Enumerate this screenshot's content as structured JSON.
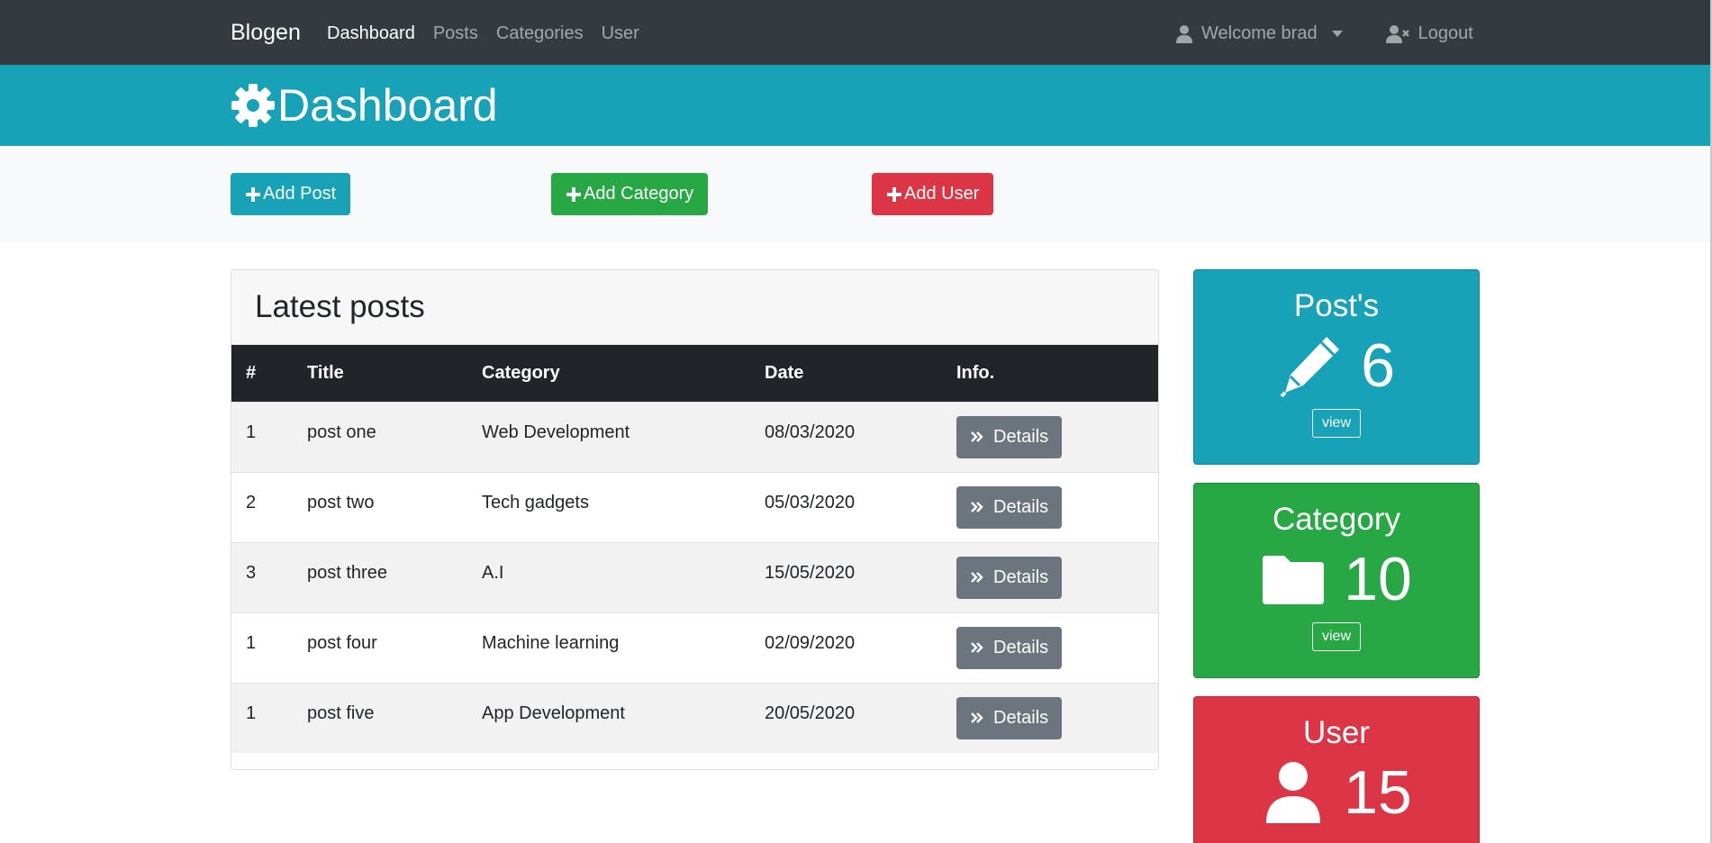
{
  "navbar": {
    "brand": "Blogen",
    "links": [
      {
        "label": "Dashboard",
        "active": true
      },
      {
        "label": "Posts",
        "active": false
      },
      {
        "label": "Categories",
        "active": false
      },
      {
        "label": "User",
        "active": false
      }
    ],
    "welcome_label": "Welcome brad",
    "logout_label": "Logout"
  },
  "header": {
    "title": "Dashboard"
  },
  "actions": {
    "add_post": "Add Post",
    "add_category": "Add Category",
    "add_user": "Add User"
  },
  "posts": {
    "title": "Latest posts",
    "columns": [
      "#",
      "Title",
      "Category",
      "Date",
      "Info."
    ],
    "rows": [
      {
        "num": "1",
        "title": "post one",
        "category": "Web Development",
        "date": "08/03/2020",
        "action": "Details"
      },
      {
        "num": "2",
        "title": "post two",
        "category": "Tech gadgets",
        "date": "05/03/2020",
        "action": "Details"
      },
      {
        "num": "3",
        "title": "post three",
        "category": "A.I",
        "date": "15/05/2020",
        "action": "Details"
      },
      {
        "num": "1",
        "title": "post four",
        "category": "Machine learning",
        "date": "02/09/2020",
        "action": "Details"
      },
      {
        "num": "1",
        "title": "post five",
        "category": "App Development",
        "date": "20/05/2020",
        "action": "Details"
      }
    ]
  },
  "stats": {
    "posts": {
      "title": "Post's",
      "value": "6",
      "button": "view",
      "icon": "pencil-icon"
    },
    "category": {
      "title": "Category",
      "value": "10",
      "button": "view",
      "icon": "folder-icon"
    },
    "user": {
      "title": "User",
      "value": "15",
      "icon": "user-icon"
    }
  },
  "colors": {
    "navbar": "#343a40",
    "info": "#17a2b8",
    "success": "#28a745",
    "danger": "#dc3545",
    "secondary": "#6c757d",
    "table_head": "#212529"
  }
}
